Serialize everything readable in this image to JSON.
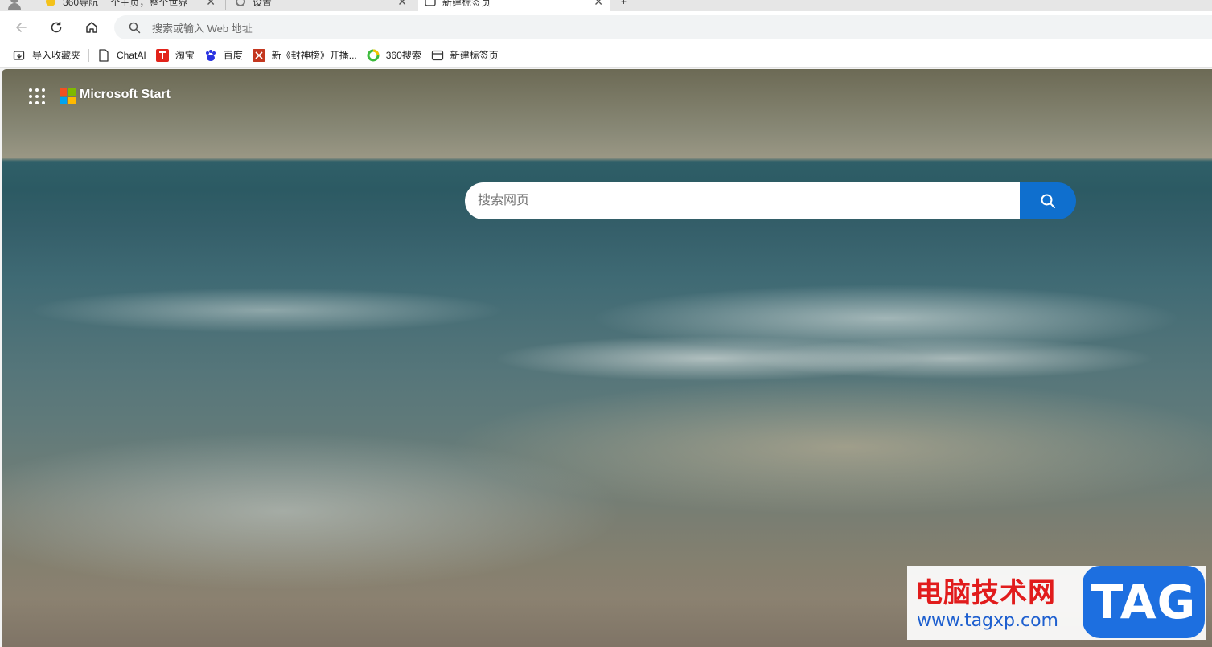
{
  "tabs": [
    {
      "label": "360导航 一个主页，整个世界",
      "active": false
    },
    {
      "label": "设置",
      "active": false
    },
    {
      "label": "新建标签页",
      "active": true
    }
  ],
  "new_tab_symbol": "+",
  "address_bar": {
    "placeholder": "搜索或输入 Web 地址"
  },
  "bookmarks": [
    {
      "label": "导入收藏夹",
      "icon": "import-favorites-icon"
    },
    {
      "label": "ChatAI",
      "icon": "page-icon"
    },
    {
      "label": "淘宝",
      "icon": "taobao-icon"
    },
    {
      "label": "百度",
      "icon": "baidu-icon"
    },
    {
      "label": "新《封神榜》开播...",
      "icon": "news-icon"
    },
    {
      "label": "360搜索",
      "icon": "360-search-icon"
    },
    {
      "label": "新建标签页",
      "icon": "new-tab-icon"
    }
  ],
  "newtab": {
    "brand": "Microsoft Start",
    "search_placeholder": "搜索网页"
  },
  "watermark": {
    "title": "电脑技术网",
    "url": "www.tagxp.com",
    "badge": "TAG"
  },
  "colors": {
    "accent": "#0f6fce",
    "ms_red": "#f25022",
    "ms_green": "#7fba00",
    "ms_blue": "#00a4ef",
    "ms_yellow": "#ffb900"
  }
}
